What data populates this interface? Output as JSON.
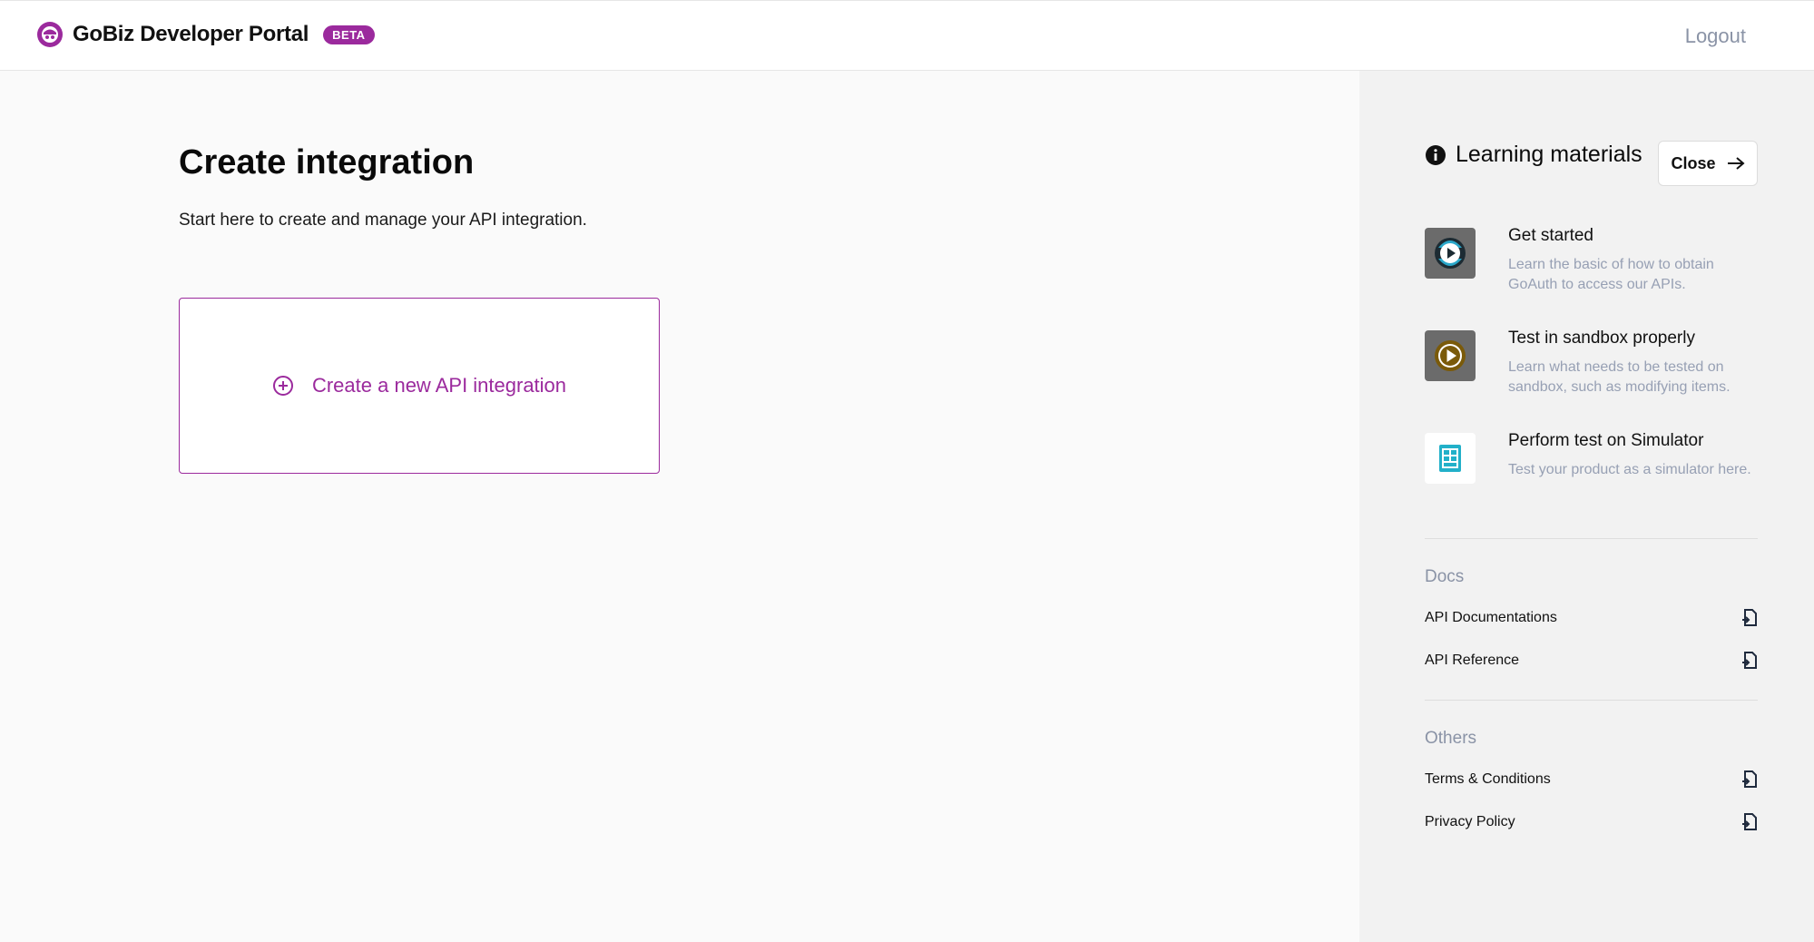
{
  "header": {
    "title": "GoBiz Developer Portal",
    "badge": "BETA",
    "logout_label": "Logout"
  },
  "main": {
    "title": "Create integration",
    "description": "Start here to create and manage your API integration.",
    "create_card_label": "Create a new API integration"
  },
  "sidebar": {
    "title": "Learning materials",
    "close_label": "Close",
    "items": [
      {
        "title": "Get started",
        "description": "Learn the basic of how to obtain GoAuth to access our APIs.",
        "icon": "video-play-icon"
      },
      {
        "title": "Test in sandbox properly",
        "description": "Learn what needs to be tested on sandbox, such as modifying items.",
        "icon": "play-icon"
      },
      {
        "title": "Perform test on Simulator",
        "description": "Test your product as a simulator here.",
        "icon": "simulator-icon"
      }
    ],
    "docs": {
      "label": "Docs",
      "links": [
        "API Documentations",
        "API Reference"
      ]
    },
    "others": {
      "label": "Others",
      "links": [
        "Terms & Conditions",
        "Privacy Policy"
      ]
    }
  },
  "colors": {
    "accent": "#9b2a9d",
    "muted": "#8a93a6",
    "sidebar_bg": "#f2f2f2"
  }
}
